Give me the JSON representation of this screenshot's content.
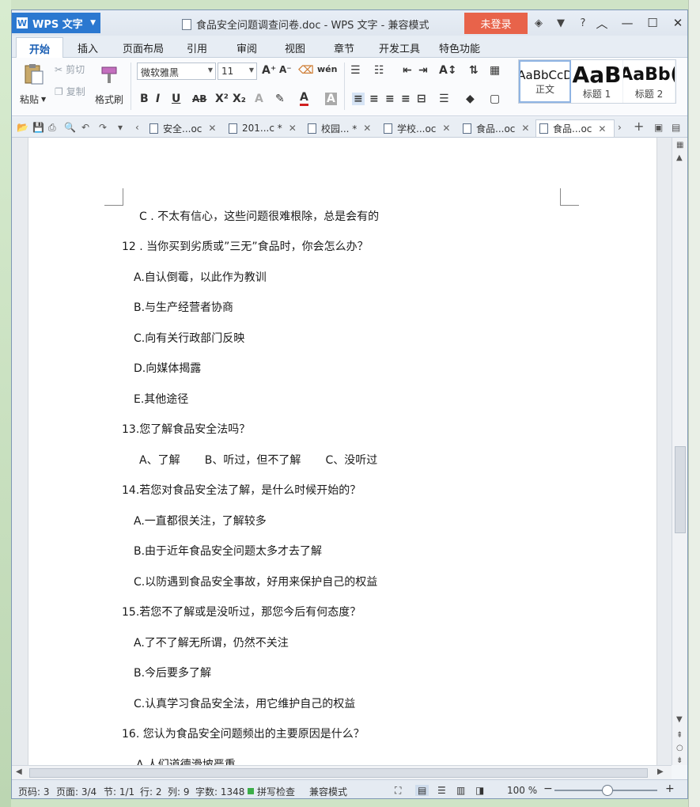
{
  "app": {
    "name": "WPS 文字",
    "window_title": "食品安全问题调查问卷.doc - WPS 文字 - 兼容模式",
    "login_label": "未登录"
  },
  "menu": {
    "tabs": [
      "开始",
      "插入",
      "页面布局",
      "引用",
      "审阅",
      "视图",
      "章节",
      "开发工具",
      "特色功能"
    ]
  },
  "ribbon": {
    "paste": "粘贴",
    "cut": "剪切",
    "copy": "复制",
    "format_painter": "格式刷",
    "font_name": "微软雅黑",
    "font_size": "11",
    "styles": [
      {
        "sample": "AaBbCcD",
        "name": "正文"
      },
      {
        "sample": "AaB",
        "name": "标题 1"
      },
      {
        "sample": "AaBb(",
        "name": "标题 2"
      }
    ]
  },
  "doc_tabs": [
    "安全...oc",
    "201...c *",
    "校园... *",
    "学校...oc",
    "食品...oc",
    "食品...oc"
  ],
  "document": {
    "lines": [
      "C . 不太有信心，这些问题很难根除，总是会有的",
      "12 . 当你买到劣质或”三无”食品时，你会怎么办？",
      "A.自认倒霉，以此作为教训",
      "B.与生产经营者协商",
      "C.向有关行政部门反映",
      "D.向媒体揭露",
      "E.其他途径",
      "13.您了解食品安全法吗？",
      "A、了解       B、听过，但不了解       C、没听过",
      "14.若您对食品安全法了解，是什么时候开始的？",
      "A.一直都很关注，了解较多",
      "B.由于近年食品安全问题太多才去了解",
      "C.以防遇到食品安全事故，好用来保护自己的权益",
      "15.若您不了解或是没听过，那您今后有何态度？",
      "A.了不了解无所谓，仍然不关注",
      "B.今后要多了解",
      "C.认真学习食品安全法，用它维护自己的权益",
      "16. 您认为食品安全问题频出的主要原因是什么？",
      "A.人们道德滑坡严重"
    ]
  },
  "status": {
    "page_code": "页码: 3",
    "page": "页面: 3/4",
    "section": "节: 1/1",
    "row": "行: 2",
    "col": "列: 9",
    "word_count": "字数: 1348",
    "spell_check": "拼写检查",
    "compat": "兼容模式",
    "zoom": "100 %"
  }
}
